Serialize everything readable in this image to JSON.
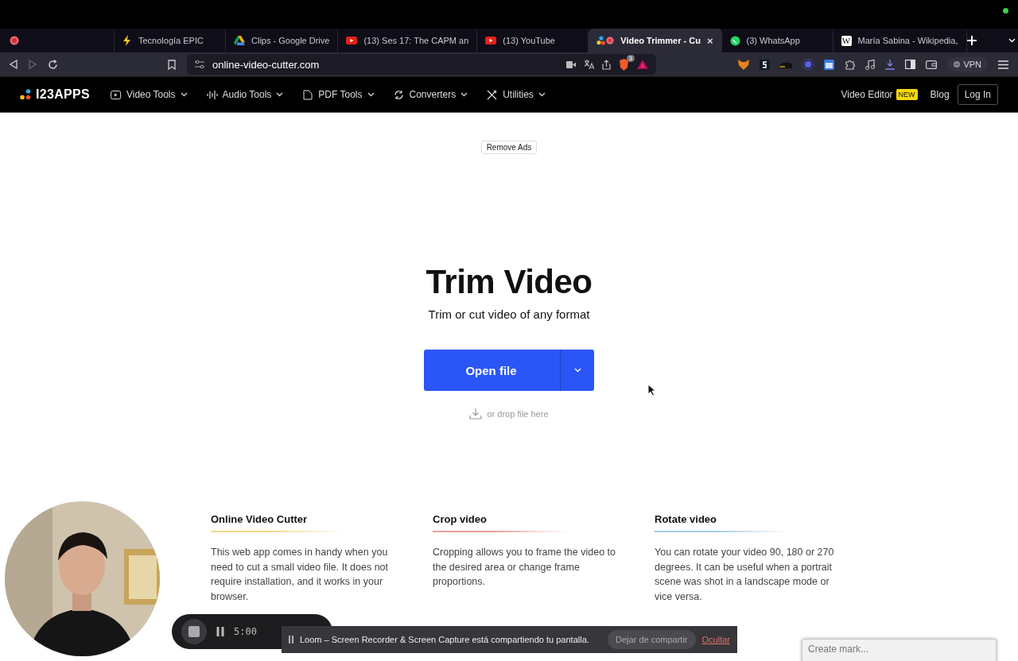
{
  "browser": {
    "tabs": [
      {
        "kind": "recording",
        "selected": false
      },
      {
        "kind": "bolt",
        "title": "Tecnología EPIC",
        "selected": false
      },
      {
        "kind": "drive",
        "title": "Clips - Google Drive",
        "selected": false
      },
      {
        "kind": "youtube",
        "title": "(13) Ses 17: The CAPM an",
        "selected": false
      },
      {
        "kind": "youtube",
        "title": "(13) YouTube",
        "selected": false
      },
      {
        "kind": "apps",
        "title": "Video Trimmer - Cu",
        "close": "×",
        "selected": true
      },
      {
        "kind": "whatsapp",
        "title": "(3) WhatsApp",
        "selected": false
      },
      {
        "kind": "wiki",
        "icon_text": "W",
        "title": "María Sabina - Wikipedia,",
        "selected": false
      }
    ],
    "forward_disabled": true,
    "url": "online-video-cutter.com",
    "shield_count": "3",
    "vpn_label": "VPN"
  },
  "site_nav": {
    "logo": "I23APPS",
    "menus": [
      "Video Tools",
      "Audio Tools",
      "PDF Tools",
      "Converters",
      "Utilities"
    ],
    "video_editor": "Video Editor",
    "badge": "NEW",
    "blog": "Blog",
    "login": "Log In"
  },
  "main": {
    "remove_ads": "Remove Ads",
    "title": "Trim Video",
    "subtitle": "Trim or cut video of any format",
    "open_button": "Open file",
    "drop_hint": "or drop file here",
    "features": [
      {
        "title": "Online Video Cutter",
        "color": "#f3d98a",
        "text": "This web app comes in handy when you need to cut a small video file. It does not require installation, and it works in your browser."
      },
      {
        "title": "Crop video",
        "color": "#ef9f98",
        "text": "Cropping allows you to frame the video to the desired area or change frame proportions."
      },
      {
        "title": "Rotate video",
        "color": "#a6cbe6",
        "text": "You can rotate your video 90, 180 or 270 degrees. It can be useful when a portrait scene was shot in a landscape mode or vice versa."
      }
    ]
  },
  "recorder": {
    "timer": "5:00"
  },
  "share_bar": {
    "message": "Loom – Screen Recorder & Screen Capture está compartiendo tu pantalla.",
    "stop_button": "Dejar de compartir",
    "hide_link": "Ocultar"
  },
  "mark_field": {
    "placeholder": "Create mark..."
  }
}
